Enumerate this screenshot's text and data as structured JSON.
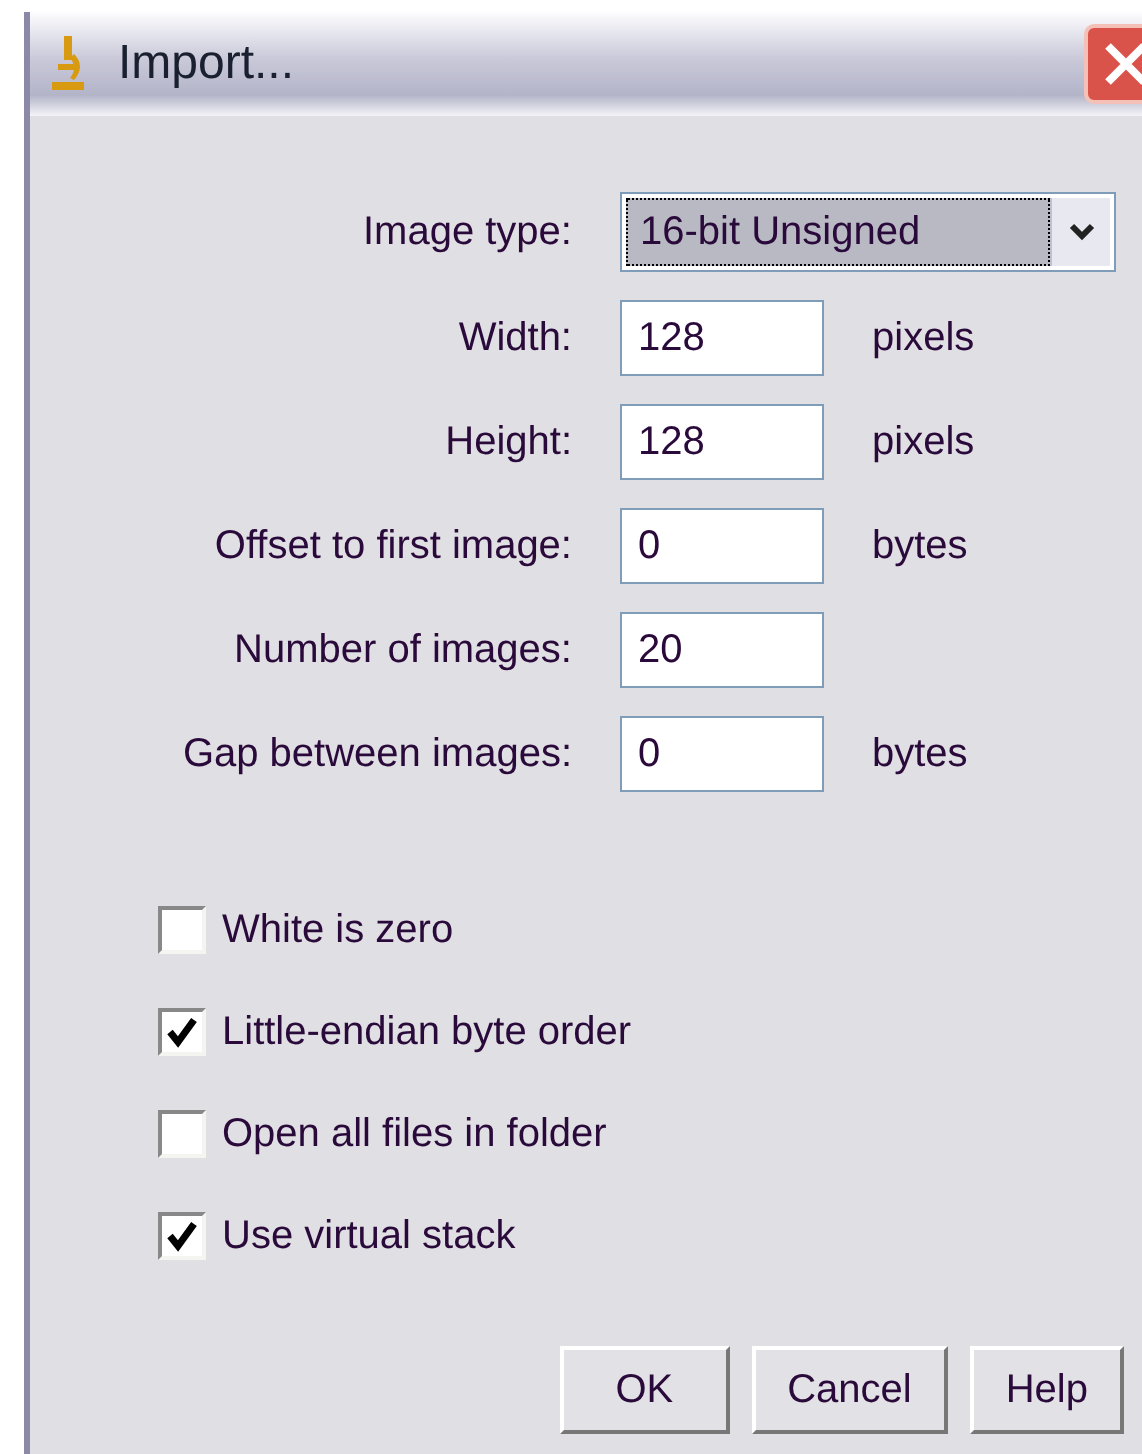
{
  "window": {
    "title": "Import..."
  },
  "image_type": {
    "label": "Image type:",
    "value": "16-bit Unsigned"
  },
  "fields": [
    {
      "label": "Width:",
      "value": "128",
      "unit": "pixels"
    },
    {
      "label": "Height:",
      "value": "128",
      "unit": "pixels"
    },
    {
      "label": "Offset to first image:",
      "value": "0",
      "unit": "bytes"
    },
    {
      "label": "Number of images:",
      "value": "20"
    },
    {
      "label": "Gap between images:",
      "value": "0",
      "unit": "bytes"
    }
  ],
  "checkboxes": [
    {
      "label": "White is zero",
      "checked": false
    },
    {
      "label": "Little-endian byte order",
      "checked": true
    },
    {
      "label": "Open all files in folder",
      "checked": false
    },
    {
      "label": "Use virtual stack",
      "checked": true
    }
  ],
  "buttons": [
    "OK",
    "Cancel",
    "Help"
  ]
}
